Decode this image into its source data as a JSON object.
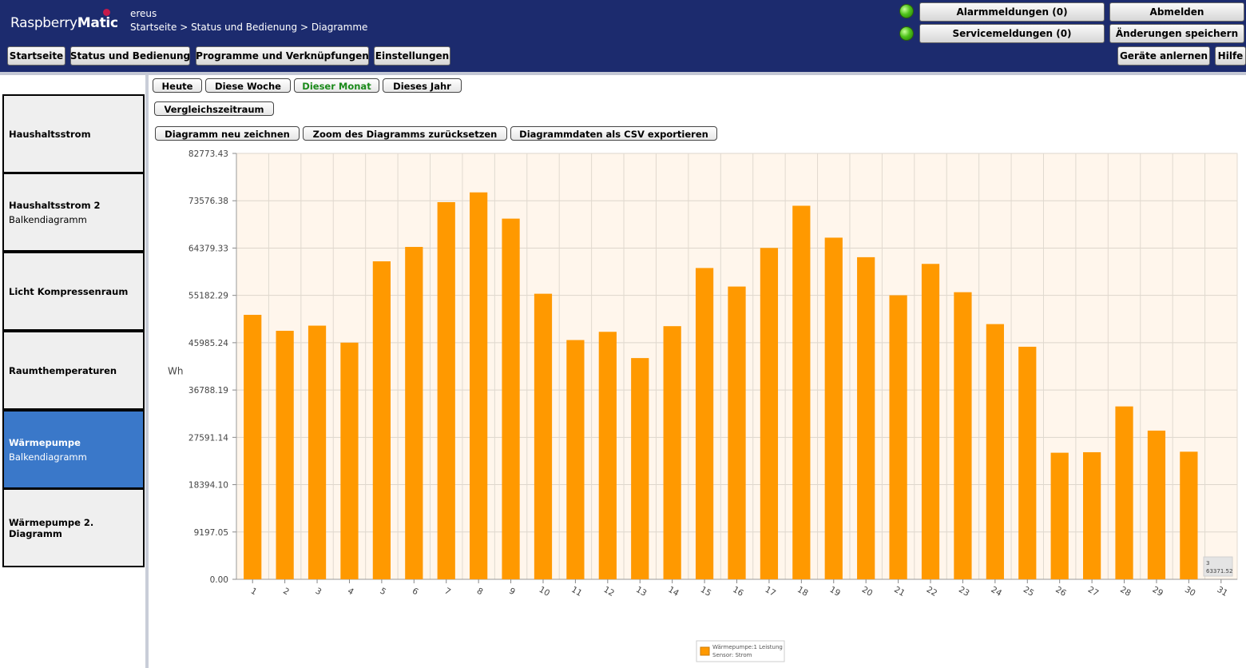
{
  "header": {
    "logo_light": "Raspberry",
    "logo_bold": "Matic",
    "hostname": "ereus",
    "breadcrumb": [
      "Startseite",
      "Status und Bedienung",
      "Diagramme"
    ],
    "breadcrumb_sep": " > ",
    "alarm_button": "Alarmmeldungen (0)",
    "service_button": "Servicemeldungen (0)",
    "logout_button": "Abmelden",
    "save_button": "Änderungen speichern",
    "nav": [
      "Startseite",
      "Status und Bedienung",
      "Programme und Verknüpfungen",
      "Einstellungen"
    ],
    "teach_button": "Geräte anlernen",
    "help_button": "Hilfe",
    "led_color": "#4ec21a"
  },
  "sidebar": {
    "items": [
      {
        "title": "Haushaltsstrom",
        "subtitle": ""
      },
      {
        "title": "Haushaltsstrom 2",
        "subtitle": "Balkendiagramm"
      },
      {
        "title": "Licht Kompressenraum",
        "subtitle": ""
      },
      {
        "title": "Raumthemperaturen",
        "subtitle": ""
      },
      {
        "title": "Wärmepumpe",
        "subtitle": "Balkendiagramm",
        "active": true
      },
      {
        "title": "Wärmepumpe 2. Diagramm",
        "subtitle": ""
      }
    ],
    "active_color": "#3a78c9"
  },
  "toolbar": {
    "ranges": [
      "Heute",
      "Diese Woche",
      "Dieser Monat",
      "Dieses Jahr"
    ],
    "selected_range": "Dieser Monat",
    "compare": "Vergleichszeitraum",
    "redraw": "Diagramm neu zeichnen",
    "reset_zoom": "Zoom des Diagramms zurücksetzen",
    "export_csv": "Diagrammdaten als CSV exportieren"
  },
  "chart_data": {
    "type": "bar",
    "ylabel": "Wh",
    "ylim": [
      0,
      82773.43
    ],
    "yticks": [
      "0.00",
      "9197.05",
      "18394.10",
      "27591.14",
      "36788.19",
      "45985.24",
      "55182.29",
      "64379.33",
      "73576.38",
      "82773.43"
    ],
    "categories": [
      "1",
      "2",
      "3",
      "4",
      "5",
      "6",
      "7",
      "8",
      "9",
      "10",
      "11",
      "12",
      "13",
      "14",
      "15",
      "16",
      "17",
      "18",
      "19",
      "20",
      "21",
      "22",
      "23",
      "24",
      "25",
      "26",
      "27",
      "28",
      "29",
      "30",
      "31"
    ],
    "series": [
      {
        "name": "Wärmepumpe:1 Leistung",
        "color": "#ff9900",
        "values": [
          51400,
          48300,
          49300,
          46000,
          61800,
          64600,
          73300,
          75200,
          70100,
          55500,
          46500,
          48100,
          43000,
          49200,
          60500,
          56900,
          64400,
          72600,
          66400,
          62600,
          55200,
          61300,
          55800,
          49600,
          45200,
          24600,
          24700,
          33600,
          28900,
          24800,
          null
        ]
      }
    ],
    "legend": {
      "line1": "Wärmepumpe:1 Leistung",
      "line2": "Sensor: Strom"
    },
    "tooltip": {
      "line1": "3",
      "line2": "63371.52"
    },
    "grid": true,
    "background": "#fff6ec"
  }
}
